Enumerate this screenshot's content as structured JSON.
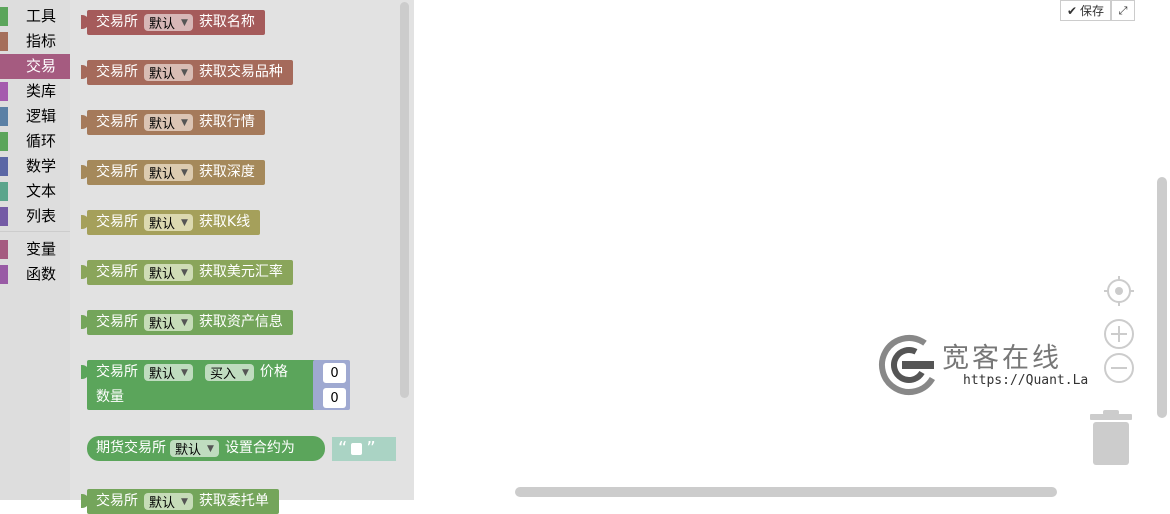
{
  "toolbox": {
    "categories": [
      {
        "label": "工具",
        "color": "#5ba55b"
      },
      {
        "label": "指标",
        "color": "#a56f5b"
      },
      {
        "label": "交易",
        "color": "#a55b80"
      },
      {
        "label": "类库",
        "color": "#a55bae"
      },
      {
        "label": "逻辑",
        "color": "#5b80a5"
      },
      {
        "label": "循环",
        "color": "#5ba55b"
      },
      {
        "label": "数学",
        "color": "#5b67a5"
      },
      {
        "label": "文本",
        "color": "#5ba58c"
      },
      {
        "label": "列表",
        "color": "#745ba5"
      },
      {
        "label": "变量",
        "color": "#a55b80"
      },
      {
        "label": "函数",
        "color": "#995ba5"
      }
    ]
  },
  "blocks": {
    "exchange_label": "交易所",
    "default_option": "默认",
    "b1": {
      "action": "获取名称",
      "color": "#a55b5b"
    },
    "b2": {
      "action": "获取交易品种",
      "color": "#a56a5b"
    },
    "b3": {
      "action": "获取行情",
      "color": "#a57a5b"
    },
    "b4": {
      "action": "获取深度",
      "color": "#a5895b"
    },
    "b5": {
      "action": "获取K线",
      "color": "#a5a05b"
    },
    "b6": {
      "action": "获取美元汇率",
      "color": "#8aa55b"
    },
    "b7": {
      "action": "获取资产信息",
      "color": "#74a55b"
    },
    "b8": {
      "side": "买入",
      "price_label": "价格",
      "qty_label": "数量",
      "price_value": "0",
      "qty_value": "0",
      "color": "#5ba55b"
    },
    "b9": {
      "prefix": "期货交易所",
      "action": "设置合约为",
      "color": "#5ba55b"
    },
    "b10": {
      "action": "获取委托单"
    }
  },
  "workspace": {
    "save_label": "保存",
    "logo_text": "宽客在线",
    "logo_url": "https://Quant.La"
  }
}
